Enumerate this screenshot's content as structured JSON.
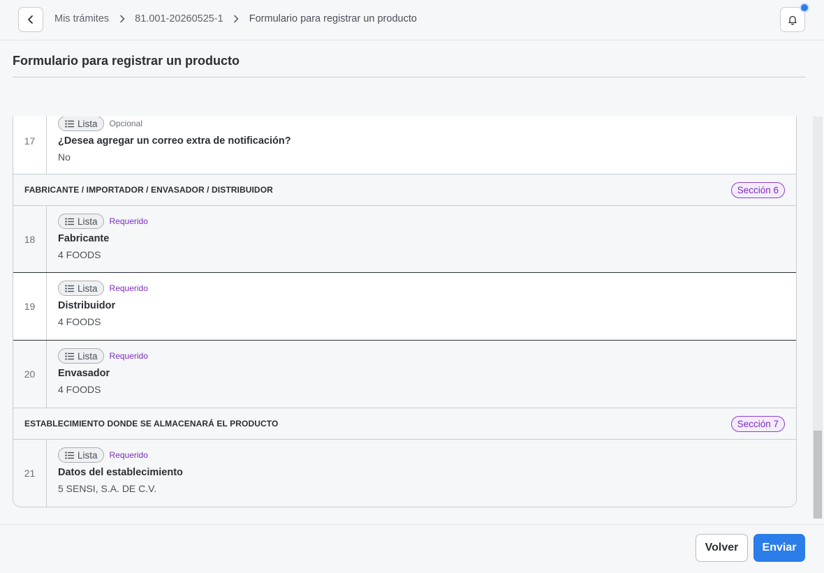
{
  "breadcrumb": {
    "items": [
      "Mis trámites",
      "81.001-20260525-1",
      "Formulario para registrar un producto"
    ]
  },
  "page": {
    "title": "Formulario para registrar un producto"
  },
  "fields": [
    {
      "number": "17",
      "type": "Lista",
      "requirement": "Opcional",
      "label": "¿Desea agregar un correo extra de notificación?",
      "value": "No"
    },
    {
      "number": "18",
      "type": "Lista",
      "requirement": "Requerido",
      "label": "Fabricante",
      "value": "4 FOODS"
    },
    {
      "number": "19",
      "type": "Lista",
      "requirement": "Requerido",
      "label": "Distribuidor",
      "value": "4 FOODS"
    },
    {
      "number": "20",
      "type": "Lista",
      "requirement": "Requerido",
      "label": "Envasador",
      "value": "4 FOODS"
    },
    {
      "number": "21",
      "type": "Lista",
      "requirement": "Requerido",
      "label": "Datos del establecimiento",
      "value": "5 SENSI, S.A. DE C.V."
    }
  ],
  "sections": [
    {
      "title": "FABRICANTE / IMPORTADOR / ENVASADOR / DISTRIBUIDOR",
      "badge": "Sección 6"
    },
    {
      "title": "ESTABLECIMIENTO DONDE SE ALMACENARÁ EL PRODUCTO",
      "badge": "Sección 7"
    }
  ],
  "footer": {
    "back_label": "Volver",
    "send_label": "Enviar"
  },
  "icons": {
    "back": "chevron-left-icon",
    "breadcrumb_separator": "chevron-right-icon",
    "notifications": "bell-icon",
    "list_type": "list-icon"
  },
  "colors": {
    "accent": "#2b7de9",
    "required": "#7b2cbf",
    "section_badge_border": "#8a3fd1"
  }
}
